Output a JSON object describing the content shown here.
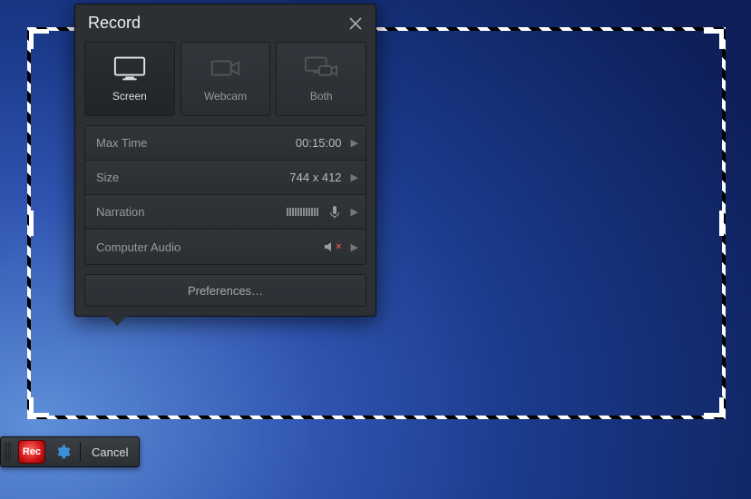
{
  "panel": {
    "title": "Record",
    "sources": {
      "screen": "Screen",
      "webcam": "Webcam",
      "both": "Both",
      "selected": "screen"
    },
    "rows": {
      "maxTime": {
        "label": "Max Time",
        "value": "00:15:00"
      },
      "size": {
        "label": "Size",
        "value": "744 x 412"
      },
      "narration": {
        "label": "Narration"
      },
      "computerAudio": {
        "label": "Computer Audio",
        "muted": true
      }
    },
    "preferences": "Preferences…"
  },
  "toolbar": {
    "rec": "Rec",
    "cancel": "Cancel"
  }
}
